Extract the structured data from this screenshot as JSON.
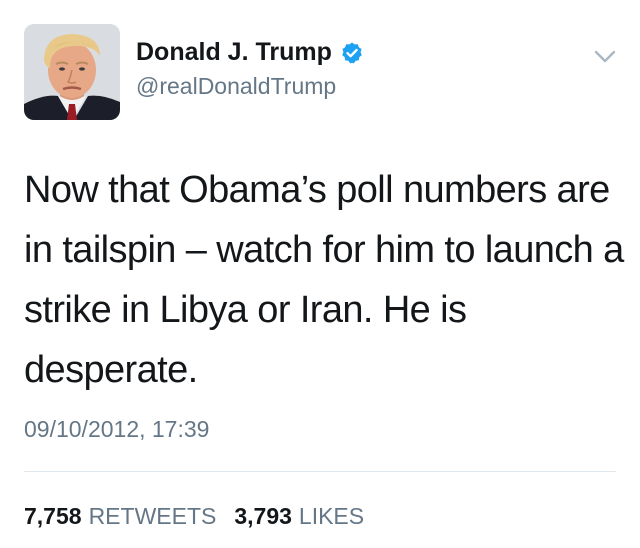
{
  "user": {
    "display_name": "Donald J. Trump",
    "handle": "@realDonaldTrump",
    "verified": true,
    "avatar_icon": "profile-photo-avatar",
    "verified_color": "#1da1f2"
  },
  "menu": {
    "icon": "chevron-down-icon"
  },
  "tweet": {
    "text": "Now that Obama’s poll numbers are in tailspin – watch for him to launch a strike in Libya or Iran.  He is desperate.",
    "timestamp": "09/10/2012, 17:39"
  },
  "stats": {
    "retweets_count": "7,758",
    "retweets_label": "RETWEETS",
    "likes_count": "3,793",
    "likes_label": "LIKES"
  },
  "colors": {
    "text_primary": "#14171a",
    "text_secondary": "#657786",
    "divider": "#e1e8ed"
  }
}
